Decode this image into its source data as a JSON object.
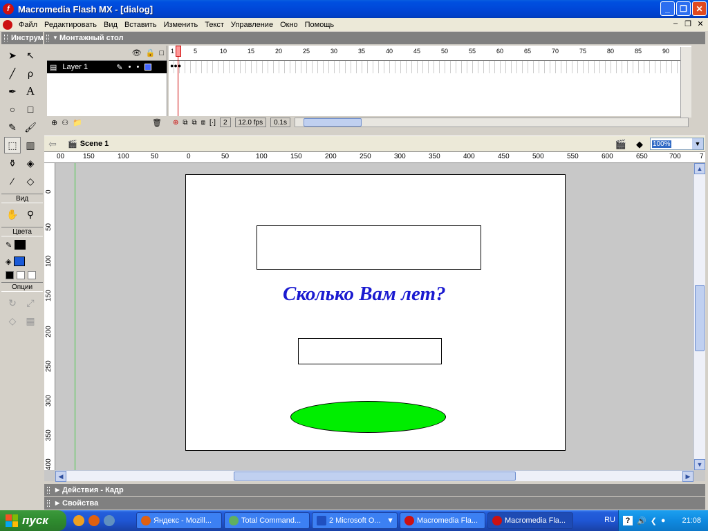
{
  "window": {
    "title": "Macromedia Flash MX - [dialog]",
    "minimize": "_",
    "maximize": "❐",
    "close": "✕"
  },
  "menu": {
    "items": [
      "Файл",
      "Редактировать",
      "Вид",
      "Вставить",
      "Изменить",
      "Текст",
      "Управление",
      "Окно",
      "Помощь"
    ]
  },
  "toolbox": {
    "title": "Инструменты",
    "view_label": "Вид",
    "colors_label": "Цвета",
    "options_label": "Опции",
    "stroke_color": "#000000",
    "fill_color": "#1a5ad8"
  },
  "timeline": {
    "title": "Монтажный стол",
    "layer_name": "Layer 1",
    "frame_numbers": [
      "1",
      "5",
      "10",
      "15",
      "20",
      "25",
      "30",
      "35",
      "40",
      "45",
      "50",
      "55",
      "60",
      "65",
      "70",
      "75",
      "80",
      "85",
      "90",
      "9"
    ],
    "current_frame": "2",
    "fps": "12.0 fps",
    "time": "0.1s"
  },
  "editbar": {
    "scene": "Scene 1",
    "zoom": "100%"
  },
  "rulers": {
    "h_labels": [
      "00",
      "150",
      "100",
      "50",
      "0",
      "50",
      "100",
      "150",
      "200",
      "250",
      "300",
      "350",
      "400",
      "450",
      "500",
      "550",
      "600",
      "650",
      "700",
      "7"
    ],
    "v_labels": [
      "0",
      "50",
      "100",
      "150",
      "200",
      "250",
      "300",
      "350",
      "400"
    ]
  },
  "stage": {
    "question": "Сколько Вам лет?",
    "question_color": "#1a1ad0",
    "ellipse_color": "#00ee00"
  },
  "panels": {
    "actions": "Действия - Кадр",
    "properties": "Свойства"
  },
  "taskbar": {
    "start": "пуск",
    "tasks": [
      "Яндекс - Mozill...",
      "Total Command...",
      "2 Microsoft O...",
      "Macromedia Fla...",
      "Macromedia Fla..."
    ],
    "lang": "RU",
    "time": "21:08"
  }
}
